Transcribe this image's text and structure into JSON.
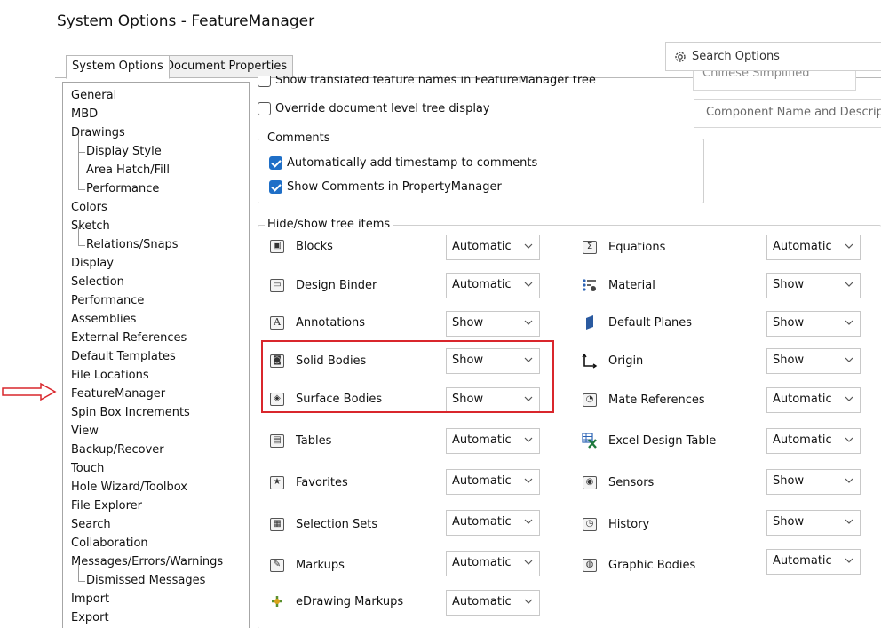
{
  "window": {
    "title": "System Options - FeatureManager"
  },
  "tabs": [
    {
      "label": "System Options",
      "active": true
    },
    {
      "label": "Document Properties",
      "active": false
    }
  ],
  "search": {
    "placeholder": "Search Options",
    "icon": "gear-icon"
  },
  "sidebar": {
    "items": [
      {
        "label": "General",
        "level": 0
      },
      {
        "label": "MBD",
        "level": 0
      },
      {
        "label": "Drawings",
        "level": 0
      },
      {
        "label": "Display Style",
        "level": 1
      },
      {
        "label": "Area Hatch/Fill",
        "level": 1
      },
      {
        "label": "Performance",
        "level": 1
      },
      {
        "label": "Colors",
        "level": 0
      },
      {
        "label": "Sketch",
        "level": 0
      },
      {
        "label": "Relations/Snaps",
        "level": 1
      },
      {
        "label": "Display",
        "level": 0
      },
      {
        "label": "Selection",
        "level": 0
      },
      {
        "label": "Performance",
        "level": 0
      },
      {
        "label": "Assemblies",
        "level": 0
      },
      {
        "label": "External References",
        "level": 0
      },
      {
        "label": "Default Templates",
        "level": 0
      },
      {
        "label": "File Locations",
        "level": 0
      },
      {
        "label": "FeatureManager",
        "level": 0,
        "selected": true
      },
      {
        "label": "Spin Box Increments",
        "level": 0
      },
      {
        "label": "View",
        "level": 0
      },
      {
        "label": "Backup/Recover",
        "level": 0
      },
      {
        "label": "Touch",
        "level": 0
      },
      {
        "label": "Hole Wizard/Toolbox",
        "level": 0
      },
      {
        "label": "File Explorer",
        "level": 0
      },
      {
        "label": "Search",
        "level": 0
      },
      {
        "label": "Collaboration",
        "level": 0
      },
      {
        "label": "Messages/Errors/Warnings",
        "level": 0
      },
      {
        "label": "Dismissed Messages",
        "level": 1
      },
      {
        "label": "Import",
        "level": 0
      },
      {
        "label": "Export",
        "level": 0
      }
    ]
  },
  "top_options": {
    "translated_names": {
      "label": "Show translated feature names in FeatureManager tree",
      "checked": false,
      "value": "Chinese Simplified"
    },
    "override_tree": {
      "label": "Override document level tree display",
      "checked": false,
      "value": "Component Name and Descripti"
    }
  },
  "comments": {
    "label": "Comments",
    "timestamp": {
      "label": "Automatically add timestamp to comments",
      "checked": true
    },
    "show_in_pm": {
      "label": "Show Comments in PropertyManager",
      "checked": true
    }
  },
  "hide_show": {
    "label": "Hide/show tree items",
    "left": [
      {
        "label": "Blocks",
        "value": "Automatic",
        "icon": "blocks-icon"
      },
      {
        "label": "Design Binder",
        "value": "Automatic",
        "icon": "design-binder-icon"
      },
      {
        "label": "Annotations",
        "value": "Show",
        "icon": "annotations-icon"
      },
      {
        "label": "Solid Bodies",
        "value": "Show",
        "icon": "solid-bodies-icon"
      },
      {
        "label": "Surface Bodies",
        "value": "Show",
        "icon": "surface-bodies-icon"
      },
      {
        "label": "Tables",
        "value": "Automatic",
        "icon": "tables-icon"
      },
      {
        "label": "Favorites",
        "value": "Automatic",
        "icon": "favorites-icon"
      },
      {
        "label": "Selection Sets",
        "value": "Automatic",
        "icon": "selection-sets-icon"
      },
      {
        "label": "Markups",
        "value": "Automatic",
        "icon": "markups-icon"
      },
      {
        "label": "eDrawing Markups",
        "value": "Automatic",
        "icon": "edrawing-markups-icon"
      }
    ],
    "right": [
      {
        "label": "Equations",
        "value": "Automatic",
        "icon": "equations-icon"
      },
      {
        "label": "Material",
        "value": "Show",
        "icon": "material-icon"
      },
      {
        "label": "Default Planes",
        "value": "Show",
        "icon": "default-planes-icon"
      },
      {
        "label": "Origin",
        "value": "Show",
        "icon": "origin-icon"
      },
      {
        "label": "Mate References",
        "value": "Automatic",
        "icon": "mate-references-icon"
      },
      {
        "label": "Excel Design Table",
        "value": "Automatic",
        "icon": "excel-design-table-icon"
      },
      {
        "label": "Sensors",
        "value": "Show",
        "icon": "sensors-icon"
      },
      {
        "label": "History",
        "value": "Show",
        "icon": "history-icon"
      },
      {
        "label": "Graphic Bodies",
        "value": "Automatic",
        "icon": "graphic-bodies-icon"
      }
    ]
  },
  "colors": {
    "highlight": "#d9262c",
    "checkbox": "#1f6fc7",
    "arrow": "#d9262c"
  }
}
